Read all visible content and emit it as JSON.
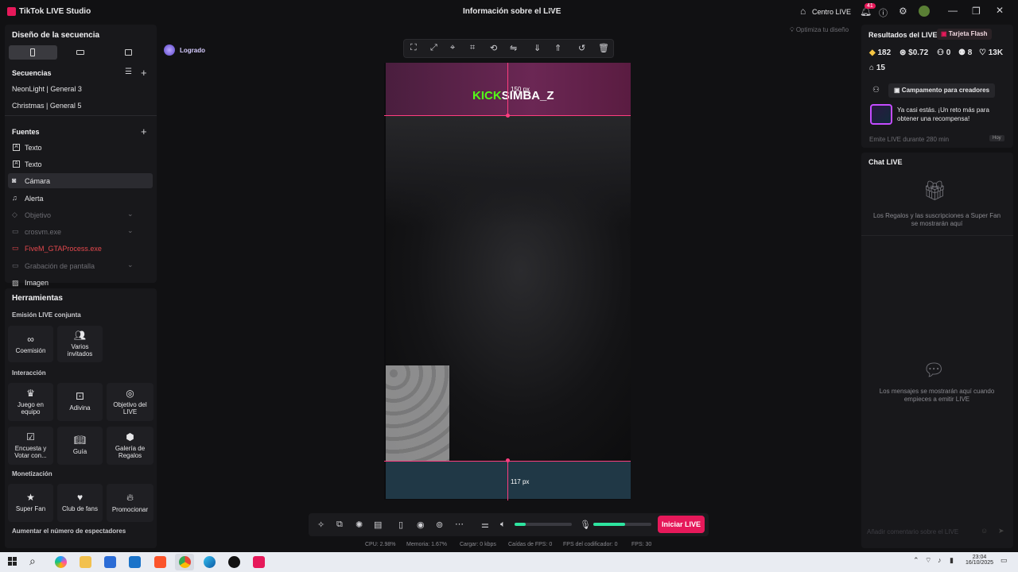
{
  "titlebar": {
    "app_title": "TikTok LIVE Studio",
    "center_title": "Información sobre el LIVE",
    "centro_live": "Centro LIVE",
    "notif_count": "41"
  },
  "left": {
    "layout_title": "Diseño de la secuencia",
    "sequences_title": "Secuencias",
    "sequences": [
      "NeonLight | General 3",
      "Christmas | General 5"
    ],
    "sources_title": "Fuentes",
    "sources": [
      {
        "label": "Texto",
        "icon": "text-icon"
      },
      {
        "label": "Texto",
        "icon": "text-icon"
      },
      {
        "label": "Cámara",
        "icon": "camera-icon"
      },
      {
        "label": "Alerta",
        "icon": "bell-icon"
      },
      {
        "label": "Objetivo",
        "icon": "target-icon"
      },
      {
        "label": "crosvm.exe",
        "icon": "app-icon"
      },
      {
        "label": "FiveM_GTAProcess.exe",
        "icon": "app-icon"
      },
      {
        "label": "Grabación de pantalla",
        "icon": "screen-icon"
      },
      {
        "label": "Imagen",
        "icon": "image-icon"
      }
    ],
    "tools_title": "Herramientas",
    "cohost_title": "Emisión LIVE conjunta",
    "cohost": [
      "Coemisión",
      "Varios invitados"
    ],
    "interaction_title": "Interacción",
    "interaction": [
      "Juego en equipo",
      "Adivina",
      "Objetivo del LIVE",
      "Encuesta y Votar con...",
      "Guía",
      "Galería de Regalos"
    ],
    "monet_title": "Monetización",
    "monet": [
      "Super Fan",
      "Club de fans",
      "Promocionar"
    ],
    "viewers_title": "Aumentar el número de espectadores"
  },
  "canvas": {
    "achievement": "Logrado",
    "optimize": "Optimiza tu diseño",
    "kick_green": "KICK",
    "kick_white": "SIMBA_Z",
    "top_px": "150 px",
    "bottom_px": "117 px",
    "start_button": "Iniciar LIVE",
    "mic_level": 0.55,
    "speaker_level": 0.2
  },
  "status": {
    "cpu": "CPU:  2.98%",
    "mem": "Memoria:  1.67%",
    "load": "Cargar:  0 kbps",
    "drops": "Caídas de FPS:  0",
    "enc": "FPS del codificador:  0",
    "fps": "FPS:  30"
  },
  "right": {
    "results_title": "Resultados del LIVE",
    "flash_badge": "Tarjeta Flash",
    "stats": [
      "182",
      "$0.72",
      "0",
      "8",
      "13K"
    ],
    "gifts": "15",
    "campaign": "Campamento para creadores",
    "reward_text": "Ya casi estás. ¡Un reto más para obtener una recompensa!",
    "emit_text": "Emite LIVE durante 280 min",
    "today": "Hoy",
    "chat_title": "Chat LIVE",
    "gifts_msg": "Los Regalos y las suscripciones a Super Fan se mostrarán aquí",
    "chat_msg": "Los mensajes se mostrarán aquí cuando empieces a emitir LIVE",
    "comment_placeholder": "Añadir comentario sobre el LIVE"
  },
  "taskbar": {
    "time": "23:04",
    "date": "16/10/2025"
  },
  "colors": {
    "accent": "#e6195a",
    "kick": "#53fc18",
    "guide": "#ff3d7f"
  }
}
